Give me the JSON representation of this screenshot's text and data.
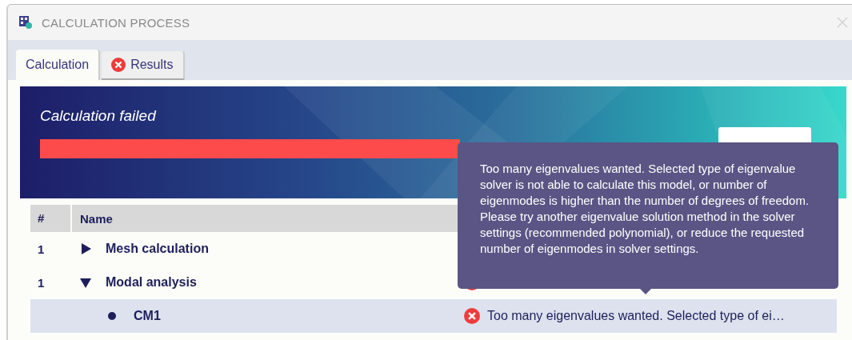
{
  "window": {
    "title": "CALCULATION PROCESS"
  },
  "tabs": [
    {
      "label": "Calculation",
      "selected": true,
      "error": false
    },
    {
      "label": "Results",
      "selected": false,
      "error": true
    }
  ],
  "banner": {
    "title": "Calculation failed",
    "progress": {
      "level": 1,
      "failed": true
    }
  },
  "table": {
    "columns": [
      "#",
      "Name"
    ],
    "rows": [
      {
        "number": "1",
        "name": "Mesh calculation",
        "expanded": false,
        "selected": false,
        "children": []
      },
      {
        "number": "1",
        "name": "Modal analysis",
        "expanded": true,
        "selected": false,
        "error": true,
        "children": [
          {
            "name": "CM1",
            "selected": true,
            "error": true,
            "message": "Too many eigenvalues wanted. Selected type of ei…"
          }
        ]
      }
    ]
  },
  "tooltip": {
    "text": "Too many eigenvalues wanted. Selected type of eigenvalue solver is not able to calculate this model, or number of eigenmodes is higher than the number of degrees of freedom. Please try another eigenvalue solution method in the solver settings (recommended polynomial), or reduce the requested number of eigenmodes in solver settings."
  }
}
